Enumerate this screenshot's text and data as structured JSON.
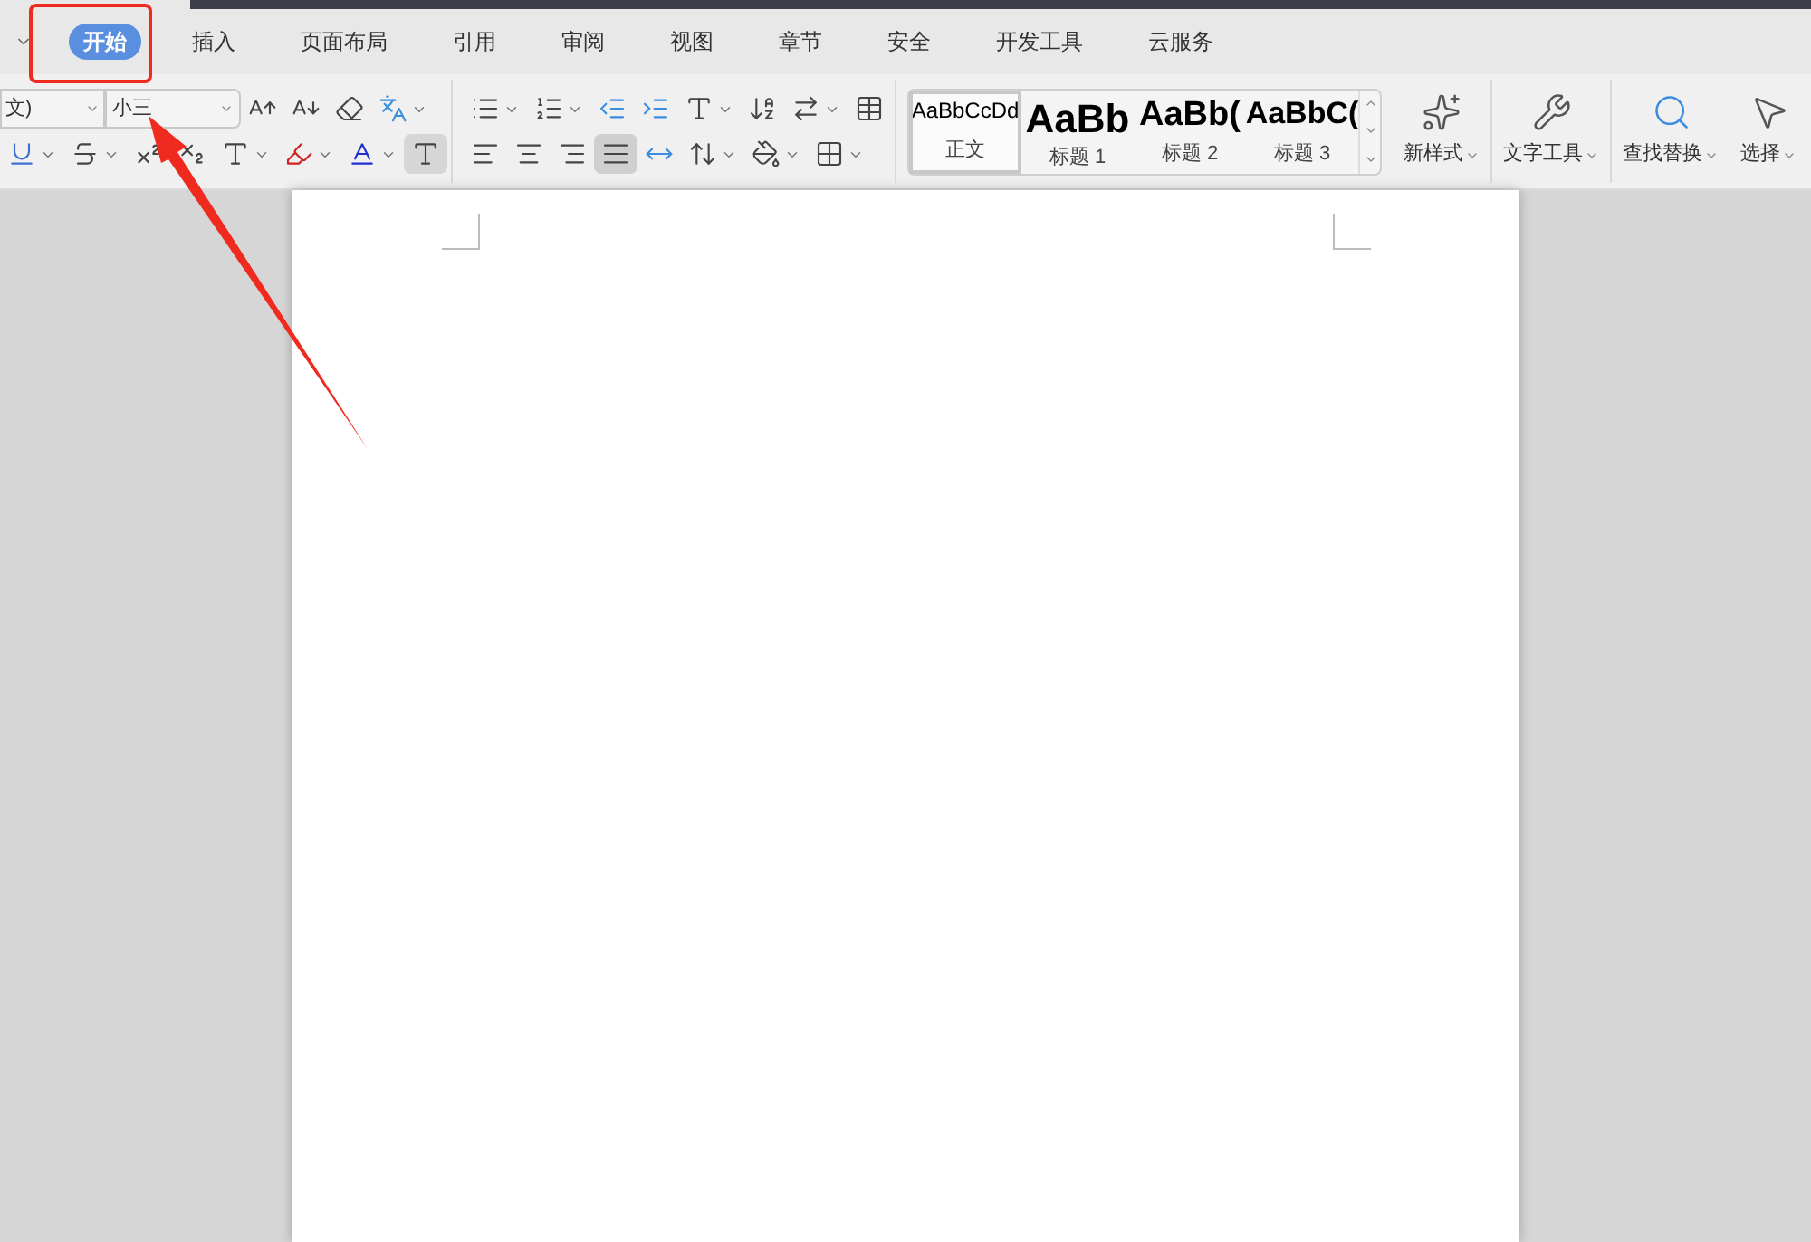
{
  "menu_tabs": [
    {
      "label": "开始",
      "selected": true
    },
    {
      "label": "插入",
      "selected": false
    },
    {
      "label": "页面布局",
      "selected": false
    },
    {
      "label": "引用",
      "selected": false
    },
    {
      "label": "审阅",
      "selected": false
    },
    {
      "label": "视图",
      "selected": false
    },
    {
      "label": "章节",
      "selected": false
    },
    {
      "label": "安全",
      "selected": false
    },
    {
      "label": "开发工具",
      "selected": false
    },
    {
      "label": "云服务",
      "selected": false
    }
  ],
  "font": {
    "name": "文)",
    "size": "小三"
  },
  "alignment": [
    {
      "kind": "left",
      "selected": false
    },
    {
      "kind": "center",
      "selected": false
    },
    {
      "kind": "right",
      "selected": false
    },
    {
      "kind": "justify",
      "selected": true
    }
  ],
  "styles": [
    {
      "preview": "AaBbCcDd",
      "label": "正文",
      "selected": true,
      "kind": "body"
    },
    {
      "preview": "AaBb",
      "label": "标题 1",
      "selected": false,
      "kind": "h1"
    },
    {
      "preview": "AaBb(",
      "label": "标题 2",
      "selected": false,
      "kind": "h2"
    },
    {
      "preview": "AaBbC(",
      "label": "标题 3",
      "selected": false,
      "kind": "h3"
    }
  ],
  "tools": [
    {
      "kind": "new-style",
      "label": "新样式"
    },
    {
      "kind": "text-tools",
      "label": "文字工具"
    },
    {
      "kind": "find-replace",
      "label": "查找替换"
    },
    {
      "kind": "select",
      "label": "选择"
    }
  ]
}
